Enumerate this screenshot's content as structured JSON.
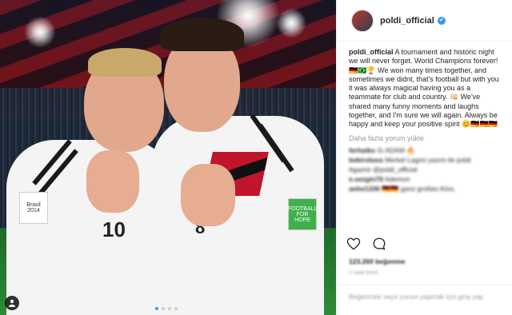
{
  "post": {
    "username": "poldi_official",
    "verified_glyph": "✔",
    "caption_user": "poldi_official",
    "caption_text": " A tournament and historic night we will never forget. World Champions forever! 🇩🇪🇧🇷🏆 We won many times together, and sometimes we didnt, that's football but with you it was always magical having you as a teammate for club and country. 👊🏻 We've shared many funny moments and laughs together, and I'm sure we will again. Always be happy and keep your positive spirit 😊🇩🇪🇩🇪🇩🇪",
    "more_comments": "Daha fazla yorum yükle",
    "comments": [
      {
        "user": "ferhatks",
        "text": " Sı ADAM 🔥"
      },
      {
        "user": "bekiroluso",
        "text": " Merkel Lagmi yazım ile poldi"
      },
      {
        "user": "",
        "text": "#gaznir @poldi_official"
      },
      {
        "user": "e.sezgin70",
        "text": " Ademon"
      },
      {
        "user": "anhe1336",
        "text": " 🇩🇪🇩🇪 ganz großes Kino."
      }
    ],
    "likes": "123.260 beğenme",
    "date": "1 saat önce",
    "add_comment_placeholder": "Beğenmek veya yorum yapmak için giriş yap"
  },
  "photo": {
    "left_player_number": "10",
    "right_player_number": "8",
    "patch_left": "Brasil 2014",
    "patch_right": "FOOTBALL FOR HOPE",
    "carousel_total": 4,
    "carousel_active": 0
  },
  "icons": {
    "heart": "heart-icon",
    "comment": "comment-icon",
    "more": "more-options-icon",
    "user_tag": "user-tag-icon"
  },
  "colors": {
    "accent": "#3897f0",
    "text": "#262626",
    "muted": "#999999",
    "grass": "#2f8a36",
    "jersey_red": "#c0152a"
  }
}
